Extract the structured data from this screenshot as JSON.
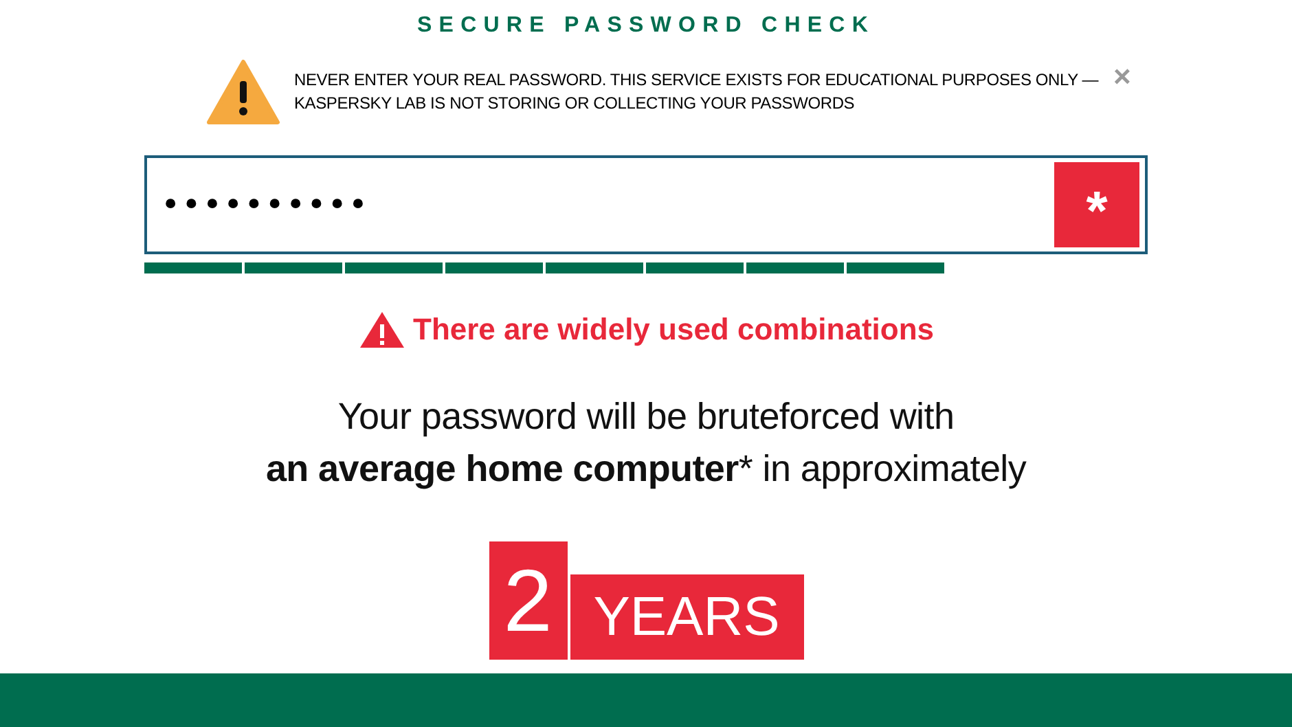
{
  "title": "SECURE PASSWORD CHECK",
  "notice": {
    "text": "NEVER ENTER YOUR REAL PASSWORD. THIS SERVICE EXISTS FOR EDUCATIONAL PURPOSES ONLY — KASPERSKY LAB IS NOT STORING OR COLLECTING YOUR PASSWORDS",
    "close": "×"
  },
  "password_field": {
    "value": "••••••••••",
    "toggle": "*"
  },
  "strength_segments": [
    {
      "filled": true
    },
    {
      "filled": true
    },
    {
      "filled": true
    },
    {
      "filled": true
    },
    {
      "filled": true
    },
    {
      "filled": true
    },
    {
      "filled": true
    },
    {
      "filled": true
    }
  ],
  "warning": "There are widely used combinations",
  "headline": {
    "line_1": "Your password will be bruteforced with",
    "line_2_bold": "an average home computer",
    "line_2_rest": "* in approximately"
  },
  "result": {
    "number": "2",
    "unit": "YEARS"
  }
}
